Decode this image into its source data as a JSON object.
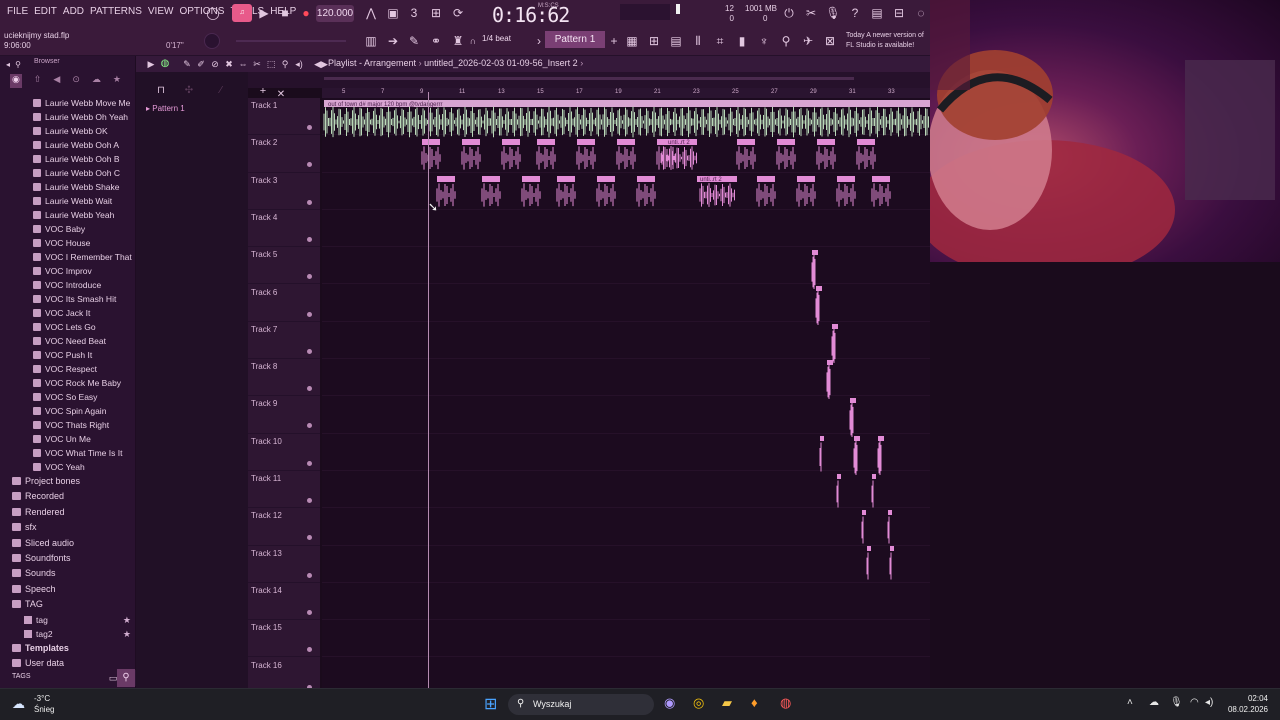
{
  "menu": [
    "FILE",
    "EDIT",
    "ADD",
    "PATTERNS",
    "VIEW",
    "OPTIONS",
    "TOOLS",
    "HELP"
  ],
  "toolbar": {
    "tempo": "120.000",
    "time": "0:16:62",
    "time_mode": "M:S:CS",
    "cpu": "12",
    "cpu_sub": "0",
    "memory": "1001 MB",
    "memory_sub": "0",
    "snap": "1/4 beat",
    "pattern": "Pattern 1",
    "news_line1": "Today   A newer version of",
    "news_line2": "FL Studio is available!"
  },
  "project": {
    "file": "ucieknijmy stad.flp",
    "time": "9:06:00",
    "offset": "0'17\""
  },
  "browser": {
    "title": "Browser",
    "files": [
      "Laurie Webb Move Me",
      "Laurie Webb Oh Yeah",
      "Laurie Webb OK",
      "Laurie Webb Ooh A",
      "Laurie Webb Ooh B",
      "Laurie Webb Ooh C",
      "Laurie Webb Shake",
      "Laurie Webb Wait",
      "Laurie Webb Yeah",
      "VOC Baby",
      "VOC House",
      "VOC I Remember That",
      "VOC Improv",
      "VOC Introduce",
      "VOC Its Smash Hit",
      "VOC Jack It",
      "VOC Lets Go",
      "VOC Need Beat",
      "VOC Push It",
      "VOC Respect",
      "VOC Rock Me Baby",
      "VOC So Easy",
      "VOC Spin Again",
      "VOC Thats Right",
      "VOC Un Me",
      "VOC What Time Is It",
      "VOC Yeah"
    ],
    "folders": [
      "Project bones",
      "Recorded",
      "Rendered",
      "sfx",
      "Sliced audio",
      "Soundfonts",
      "Sounds",
      "Speech",
      "TAG"
    ],
    "tag_items": [
      "tag",
      "tag2"
    ],
    "folders_after": [
      "Templates",
      "User data"
    ],
    "tags_label": "TAGS"
  },
  "picker": {
    "pattern": "Pattern 1"
  },
  "playlist": {
    "title": "Playlist - Arrangement",
    "breadcrumb": "untitled_2026-02-03 01-09-56_Insert 2",
    "tracks": [
      "Track 1",
      "Track 2",
      "Track 3",
      "Track 4",
      "Track 5",
      "Track 6",
      "Track 7",
      "Track 8",
      "Track 9",
      "Track 10",
      "Track 11",
      "Track 12",
      "Track 13",
      "Track 14",
      "Track 15",
      "Track 16"
    ],
    "ruler": [
      "5",
      "7",
      "9",
      "11",
      "13",
      "15",
      "17",
      "19",
      "21",
      "23",
      "25",
      "27",
      "29",
      "31",
      "33"
    ],
    "main_clip_label": "out of town d# major 120 bpm @tvdangerrr",
    "clip_label_short": "unti..rt 2"
  },
  "taskbar": {
    "temperature": "-3°C",
    "weather": "Śnieg",
    "search": "Wyszukaj",
    "time": "02:04",
    "date": "08.02.2026"
  },
  "colors": {
    "clip_pink": "#e28bd6",
    "clip_green": "#b9d8b8",
    "accent": "#e85a8a"
  }
}
